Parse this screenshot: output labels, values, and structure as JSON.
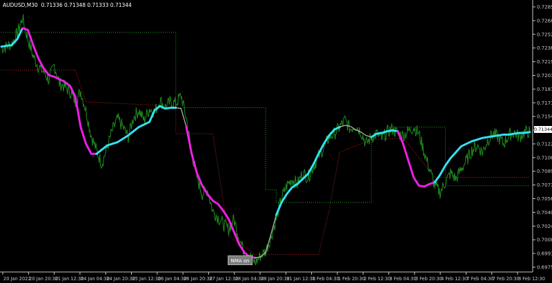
{
  "header": {
    "symbol": "AUDUSD,M30",
    "prices": "0.71336 0.71348 0.71333 0.71344"
  },
  "button": {
    "label": "NMA on"
  },
  "current_price": "0.71344",
  "colors": {
    "background": "#000000",
    "price_line": "#1e8c1e",
    "ma_up": "#33e1f0",
    "ma_down": "#ee1fe6",
    "ma_flat": "#c0c0c0",
    "stop_up": "#2aa52a",
    "stop_down": "#c0281e",
    "axis": "#c8c8c8"
  },
  "chart_data": {
    "type": "line",
    "y_ticks": [
      "0.72850",
      "0.72685",
      "0.72525",
      "0.72360",
      "0.72195",
      "0.72035",
      "0.71870",
      "0.71710",
      "0.71545",
      "0.71385",
      "0.71220",
      "0.71060",
      "0.70895",
      "0.70730",
      "0.70565",
      "0.70405",
      "0.70240",
      "0.70080",
      "0.69915",
      "0.69755"
    ],
    "x_ticks": [
      "20 Jan 2022",
      "20 Jan 20:30",
      "21 Jan 12:30",
      "24 Jan 04:30",
      "24 Jan 20:30",
      "25 Jan 12:30",
      "26 Jan 04:30",
      "26 Jan 20:30",
      "27 Jan 12:30",
      "28 Jan 04:30",
      "28 Jan 20:30",
      "31 Jan 12:30",
      "1 Feb 04:30",
      "1 Feb 20:30",
      "2 Feb 12:30",
      "3 Feb 04:30",
      "3 Feb 20:30",
      "4 Feb 12:30",
      "7 Feb 04:30",
      "7 Feb 20:30",
      "8 Feb 12:30"
    ],
    "ylim": [
      0.6967,
      0.729
    ],
    "grid": false,
    "price_series": {
      "x": [
        0,
        1,
        2,
        3,
        4,
        5,
        6,
        7,
        8,
        9,
        10,
        11,
        12,
        13,
        14,
        15,
        16,
        17,
        18,
        19,
        20,
        21,
        22,
        23,
        24,
        25,
        26,
        27,
        28,
        29,
        30,
        31,
        32,
        33,
        34,
        35,
        36,
        37,
        38,
        39,
        40,
        41,
        42,
        43,
        44,
        45,
        46,
        47,
        48,
        49,
        50,
        51,
        52,
        53,
        54,
        55,
        56,
        57,
        58,
        59,
        60,
        61,
        62,
        63,
        64,
        65,
        66,
        67,
        68,
        69,
        70,
        71,
        72,
        73,
        74,
        75,
        76,
        77,
        78,
        79,
        80,
        81,
        82,
        83,
        84,
        85,
        86,
        87,
        88,
        89,
        90,
        91,
        92,
        93,
        94,
        95,
        96,
        97,
        98,
        99,
        100
      ],
      "y": [
        0.7234,
        0.7236,
        0.724,
        0.7252,
        0.727,
        0.7245,
        0.7225,
        0.7212,
        0.7206,
        0.7196,
        0.7214,
        0.7192,
        0.7188,
        0.7182,
        0.717,
        0.7183,
        0.716,
        0.713,
        0.7112,
        0.7096,
        0.7115,
        0.7136,
        0.715,
        0.714,
        0.7128,
        0.7152,
        0.716,
        0.7148,
        0.7162,
        0.7158,
        0.7172,
        0.7164,
        0.717,
        0.7168,
        0.7178,
        0.715,
        0.711,
        0.708,
        0.706,
        0.7065,
        0.704,
        0.7032,
        0.7024,
        0.7018,
        0.703,
        0.7008,
        0.699,
        0.6986,
        0.6978,
        0.6986,
        0.6992,
        0.7008,
        0.703,
        0.7055,
        0.707,
        0.7078,
        0.7072,
        0.7085,
        0.708,
        0.7092,
        0.7105,
        0.7115,
        0.7128,
        0.7132,
        0.714,
        0.7148,
        0.7138,
        0.7142,
        0.7135,
        0.712,
        0.7128,
        0.7132,
        0.7126,
        0.7134,
        0.7138,
        0.7132,
        0.713,
        0.7135,
        0.714,
        0.7132,
        0.711,
        0.709,
        0.707,
        0.7062,
        0.7074,
        0.7085,
        0.7078,
        0.709,
        0.71,
        0.7112,
        0.7118,
        0.711,
        0.7124,
        0.7132,
        0.7128,
        0.712,
        0.713,
        0.7134,
        0.7128,
        0.7134,
        0.71344
      ]
    },
    "ma_series": {
      "x": [
        0,
        1,
        2,
        3,
        4,
        5,
        6,
        7,
        8,
        9,
        10,
        11,
        12,
        13,
        14,
        15,
        16,
        17,
        18,
        19,
        20,
        21,
        22,
        23,
        24,
        25,
        26,
        27,
        28,
        29,
        30,
        31,
        32,
        33,
        34,
        35,
        36,
        37,
        38,
        39,
        40,
        41,
        42,
        43,
        44,
        45,
        46,
        47,
        48,
        49,
        50,
        51,
        52,
        53,
        54,
        55,
        56,
        57,
        58,
        59,
        60,
        61,
        62,
        63,
        64,
        65,
        66,
        67,
        68,
        69,
        70,
        71,
        72,
        73,
        74,
        75,
        76,
        77,
        78,
        79,
        80,
        81,
        82,
        83,
        84,
        85,
        86,
        87,
        88,
        89,
        90,
        91,
        92,
        93,
        94,
        95,
        96,
        97,
        98,
        99,
        100
      ],
      "y": [
        0.7236,
        0.7237,
        0.7238,
        0.7245,
        0.7258,
        0.7256,
        0.7238,
        0.7222,
        0.721,
        0.7202,
        0.72,
        0.7197,
        0.7194,
        0.7189,
        0.7176,
        0.714,
        0.712,
        0.7108,
        0.7108,
        0.7113,
        0.7118,
        0.712,
        0.7122,
        0.7126,
        0.713,
        0.7135,
        0.714,
        0.7143,
        0.7146,
        0.716,
        0.7165,
        0.7162,
        0.7163,
        0.7163,
        0.7162,
        0.714,
        0.7108,
        0.7085,
        0.707,
        0.706,
        0.7052,
        0.7048,
        0.704,
        0.703,
        0.7015,
        0.7,
        0.699,
        0.6985,
        0.6984,
        0.6985,
        0.699,
        0.7012,
        0.7035,
        0.705,
        0.706,
        0.7068,
        0.7072,
        0.7078,
        0.7084,
        0.7095,
        0.7108,
        0.712,
        0.713,
        0.7137,
        0.714,
        0.7142,
        0.7141,
        0.7137,
        0.7134,
        0.713,
        0.7128,
        0.7132,
        0.7133,
        0.7135,
        0.7136,
        0.7135,
        0.712,
        0.71,
        0.708,
        0.707,
        0.7069,
        0.7072,
        0.7074,
        0.7083,
        0.7094,
        0.7103,
        0.711,
        0.7117,
        0.712,
        0.7123,
        0.7125,
        0.7127,
        0.7128,
        0.7129,
        0.713,
        0.7131,
        0.7131,
        0.7132,
        0.7133,
        0.7133,
        0.7134
      ],
      "segments": [
        {
          "from": 0,
          "to": 4,
          "trend": "up"
        },
        {
          "from": 4,
          "to": 14,
          "trend": "down"
        },
        {
          "from": 14,
          "to": 18,
          "trend": "down"
        },
        {
          "from": 18,
          "to": 33,
          "trend": "up"
        },
        {
          "from": 33,
          "to": 35,
          "trend": "flat"
        },
        {
          "from": 35,
          "to": 48,
          "trend": "down"
        },
        {
          "from": 48,
          "to": 52,
          "trend": "flat"
        },
        {
          "from": 52,
          "to": 64,
          "trend": "up"
        },
        {
          "from": 64,
          "to": 70,
          "trend": "flat"
        },
        {
          "from": 70,
          "to": 75,
          "trend": "up"
        },
        {
          "from": 75,
          "to": 82,
          "trend": "down"
        },
        {
          "from": 82,
          "to": 100,
          "trend": "up"
        }
      ]
    },
    "stop_up_series": {
      "x": [
        0,
        28,
        33,
        33,
        50,
        50,
        52,
        52,
        70,
        70,
        75,
        75,
        84,
        84,
        100
      ],
      "y": [
        0.7253,
        0.7253,
        0.7253,
        0.7163,
        0.7163,
        0.7065,
        0.7065,
        0.705,
        0.705,
        0.7125,
        0.714,
        0.714,
        0.714,
        0.707,
        0.707
      ]
    },
    "stop_down_series": {
      "x": [
        0,
        14,
        16,
        33,
        33,
        40,
        43,
        48,
        56,
        60,
        62,
        64,
        70,
        76,
        82,
        84,
        100
      ],
      "y": [
        0.7208,
        0.7208,
        0.717,
        0.7165,
        0.7132,
        0.7132,
        0.701,
        0.6988,
        0.6988,
        0.6988,
        0.704,
        0.711,
        0.7125,
        0.7127,
        0.708,
        0.708,
        0.708
      ]
    }
  }
}
